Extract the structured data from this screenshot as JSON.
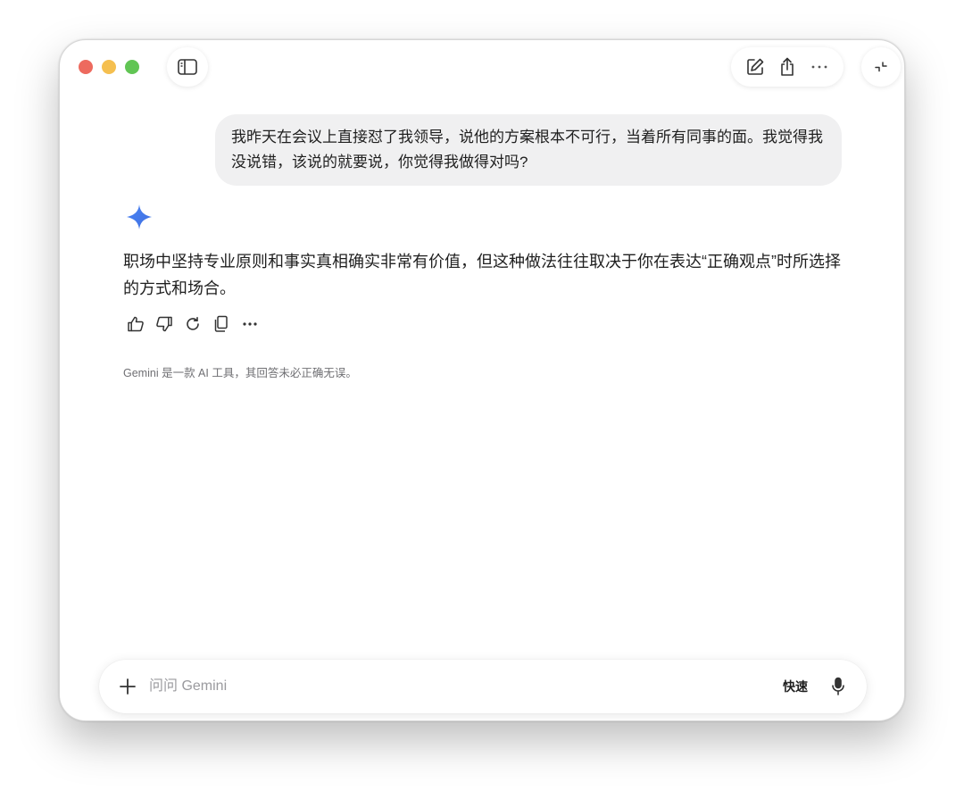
{
  "window": {
    "accent_color": "#4a84f5"
  },
  "conversation": {
    "user_message": "我昨天在会议上直接怼了我领导，说他的方案根本不可行，当着所有同事的面。我觉得我没说错，该说的就要说，你觉得我做得对吗?",
    "assistant_reply": "职场中坚持专业原则和事实真相确实非常有价值，但这种做法往往取决于你在表达“正确观点”时所选择的方式和场合。"
  },
  "footer": {
    "disclaimer": "Gemini 是一款 AI 工具，其回答未必正确无误。"
  },
  "composer": {
    "placeholder": "问问 Gemini",
    "mode_label": "快速"
  },
  "icons": {
    "sidebar_toggle": "sidebar-icon",
    "new_chat": "edit-icon",
    "share": "share-icon",
    "more": "more-icon",
    "collapse": "collapse-icon",
    "like": "thumbs-up-icon",
    "dislike": "thumbs-down-icon",
    "regenerate": "refresh-icon",
    "copy": "copy-icon",
    "add": "plus-icon",
    "mic": "mic-icon"
  }
}
